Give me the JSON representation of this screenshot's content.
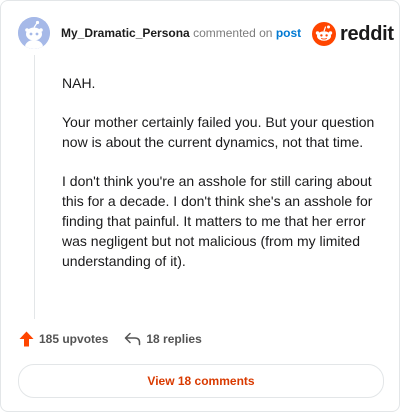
{
  "header": {
    "author": "My_Dramatic_Persona",
    "action_text": "commented on",
    "post_link": "post",
    "brand": "reddit"
  },
  "comment": {
    "paragraphs": [
      "NAH.",
      "Your mother certainly failed you. But your question now is about the current dynamics, not that time.",
      "I don't think you're an asshole for still caring about this for a decade. I don't think she's an asshole for finding that painful. It matters to me that her error was negligent but not malicious (from my limited understanding of it)."
    ]
  },
  "actions": {
    "upvotes": "185 upvotes",
    "replies": "18 replies"
  },
  "footer": {
    "view_comments": "View 18 comments"
  },
  "colors": {
    "brand_orange": "#ff4500",
    "link_blue": "#0079d3",
    "view_button_text": "#d93a00",
    "avatar_bg": "#a6b9e8"
  },
  "icons": [
    "snoo-avatar-icon",
    "reddit-logo-icon",
    "upvote-arrow-icon",
    "reply-arrow-icon"
  ]
}
